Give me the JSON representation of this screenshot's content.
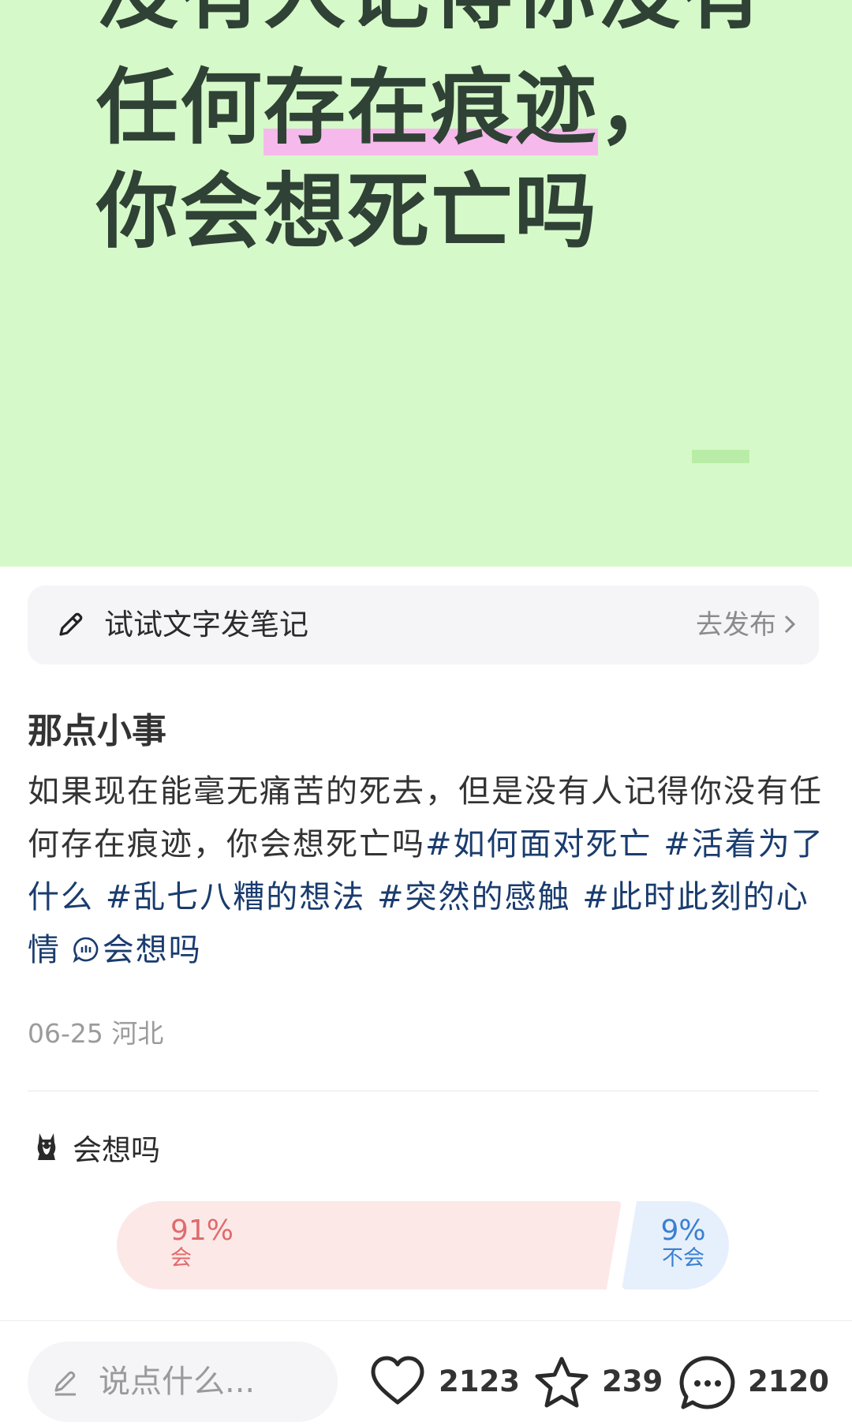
{
  "cover": {
    "line0": "没有人记得你没有",
    "line1_pre": "任何",
    "line1_highlight": "存在痕迹",
    "line1_post": "，",
    "line2": "你会想死亡吗"
  },
  "prompt_bar": {
    "text": "试试文字发笔记",
    "publish": "去发布"
  },
  "post": {
    "title": "那点小事",
    "body": "如果现在能毫无痛苦的死去，但是没有人记得你没有任何存在痕迹，你会想死亡吗",
    "tags": [
      "#如何面对死亡",
      "#活着为了什么",
      "#乱七八糟的想法",
      "#突然的感触",
      "#此时此刻的心情"
    ],
    "topic": "会想吗",
    "date": "06-25",
    "location": "河北"
  },
  "poll": {
    "title": "会想吗",
    "options": [
      {
        "percent": "91%",
        "label": "会",
        "fraction": 0.91,
        "color": "#e06b6b"
      },
      {
        "percent": "9%",
        "label": "不会",
        "fraction": 0.09,
        "color": "#3b7fd1"
      }
    ]
  },
  "bottom_bar": {
    "comment_placeholder": "说点什么...",
    "likes": "2123",
    "favorites": "239",
    "comments": "2120"
  },
  "icons": {
    "prompt": "pencil-icon",
    "publish": "chevron-right-icon",
    "topic": "chat-bubble-icon",
    "poll": "cat-avatar-icon",
    "comment_input": "pen-icon",
    "like": "heart-icon",
    "favorite": "star-icon",
    "comment": "comment-icon"
  }
}
